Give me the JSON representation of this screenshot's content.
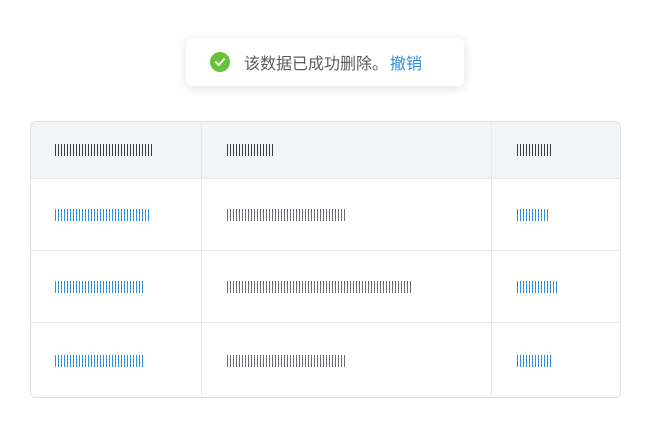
{
  "toast": {
    "icon": "check-circle-icon",
    "message": "该数据已成功删除。",
    "action_label": "撤销",
    "success_color": "#67c23a",
    "link_color": "#2b8fe5"
  },
  "table": {
    "columns": [
      {
        "label": "||||||||||||||||||||||||||||||||"
      },
      {
        "label": "||||||||||||||||"
      },
      {
        "label": "||||||||||||"
      }
    ],
    "rows": [
      {
        "col1": "||||||||||||||||||||||||||||||",
        "col2": "||||||||||||||||||||||||||||||||||||||",
        "col3": "||||||||||"
      },
      {
        "col1": "||||||||||||||||||||||||||||",
        "col2": "||||||||||||||||||||||||||||||||||||||||||||||||||||||||||",
        "col3": "|||||||||||||"
      },
      {
        "col1": "||||||||||||||||||||||||||||",
        "col2": "||||||||||||||||||||||||||||||||||||||",
        "col3": "|||||||||||"
      }
    ]
  }
}
